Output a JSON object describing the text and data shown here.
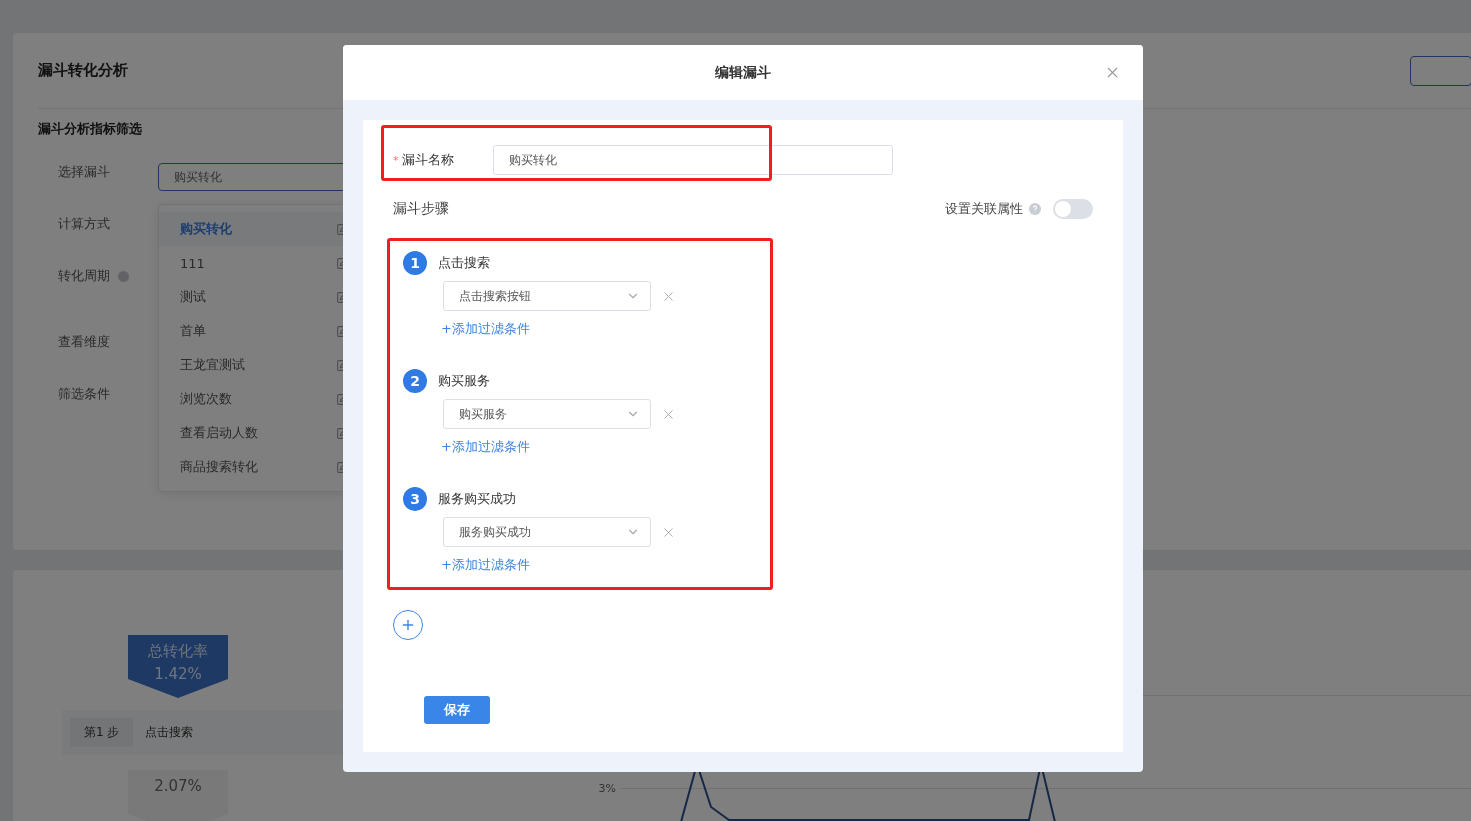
{
  "page": {
    "title": "漏斗转化分析",
    "section_title": "漏斗分析指标筛选",
    "form_labels": [
      {
        "label": "选择漏斗",
        "help": false
      },
      {
        "label": "计算方式",
        "help": false
      },
      {
        "label": "转化周期",
        "help": true
      },
      {
        "label": "查看维度",
        "help": false
      },
      {
        "label": "筛选条件",
        "help": false
      }
    ],
    "funnel_select": {
      "value": "购买转化"
    },
    "funnel_options": [
      {
        "label": "购买转化",
        "selected": true
      },
      {
        "label": "111",
        "selected": false
      },
      {
        "label": "测试",
        "selected": false
      },
      {
        "label": "首单",
        "selected": false
      },
      {
        "label": "王龙宜测试",
        "selected": false
      },
      {
        "label": "浏览次数",
        "selected": false
      },
      {
        "label": "查看启动人数",
        "selected": false
      },
      {
        "label": "商品搜索转化",
        "selected": false
      }
    ]
  },
  "funnel_chart": {
    "total_label": "总转化率",
    "total_rate": "1.42%",
    "step_badge": "第1 步",
    "step_name": "点击搜索",
    "step_rate": "2.07%"
  },
  "trend_chart": {
    "tick": "3%"
  },
  "dialog": {
    "title": "编辑漏斗",
    "required_mark": "*",
    "name_label": "漏斗名称",
    "name_value": "购买转化",
    "steps_label": "漏斗步骤",
    "link_label": "设置关联属性",
    "link_on": false,
    "steps": [
      {
        "number": "1",
        "name": "点击搜索",
        "event": "点击搜索按钮",
        "add_filter": "+添加过滤条件"
      },
      {
        "number": "2",
        "name": "购买服务",
        "event": "购买服务",
        "add_filter": "+添加过滤条件"
      },
      {
        "number": "3",
        "name": "服务购买成功",
        "event": "服务购买成功",
        "add_filter": "+添加过滤条件"
      }
    ],
    "save": "保存"
  }
}
